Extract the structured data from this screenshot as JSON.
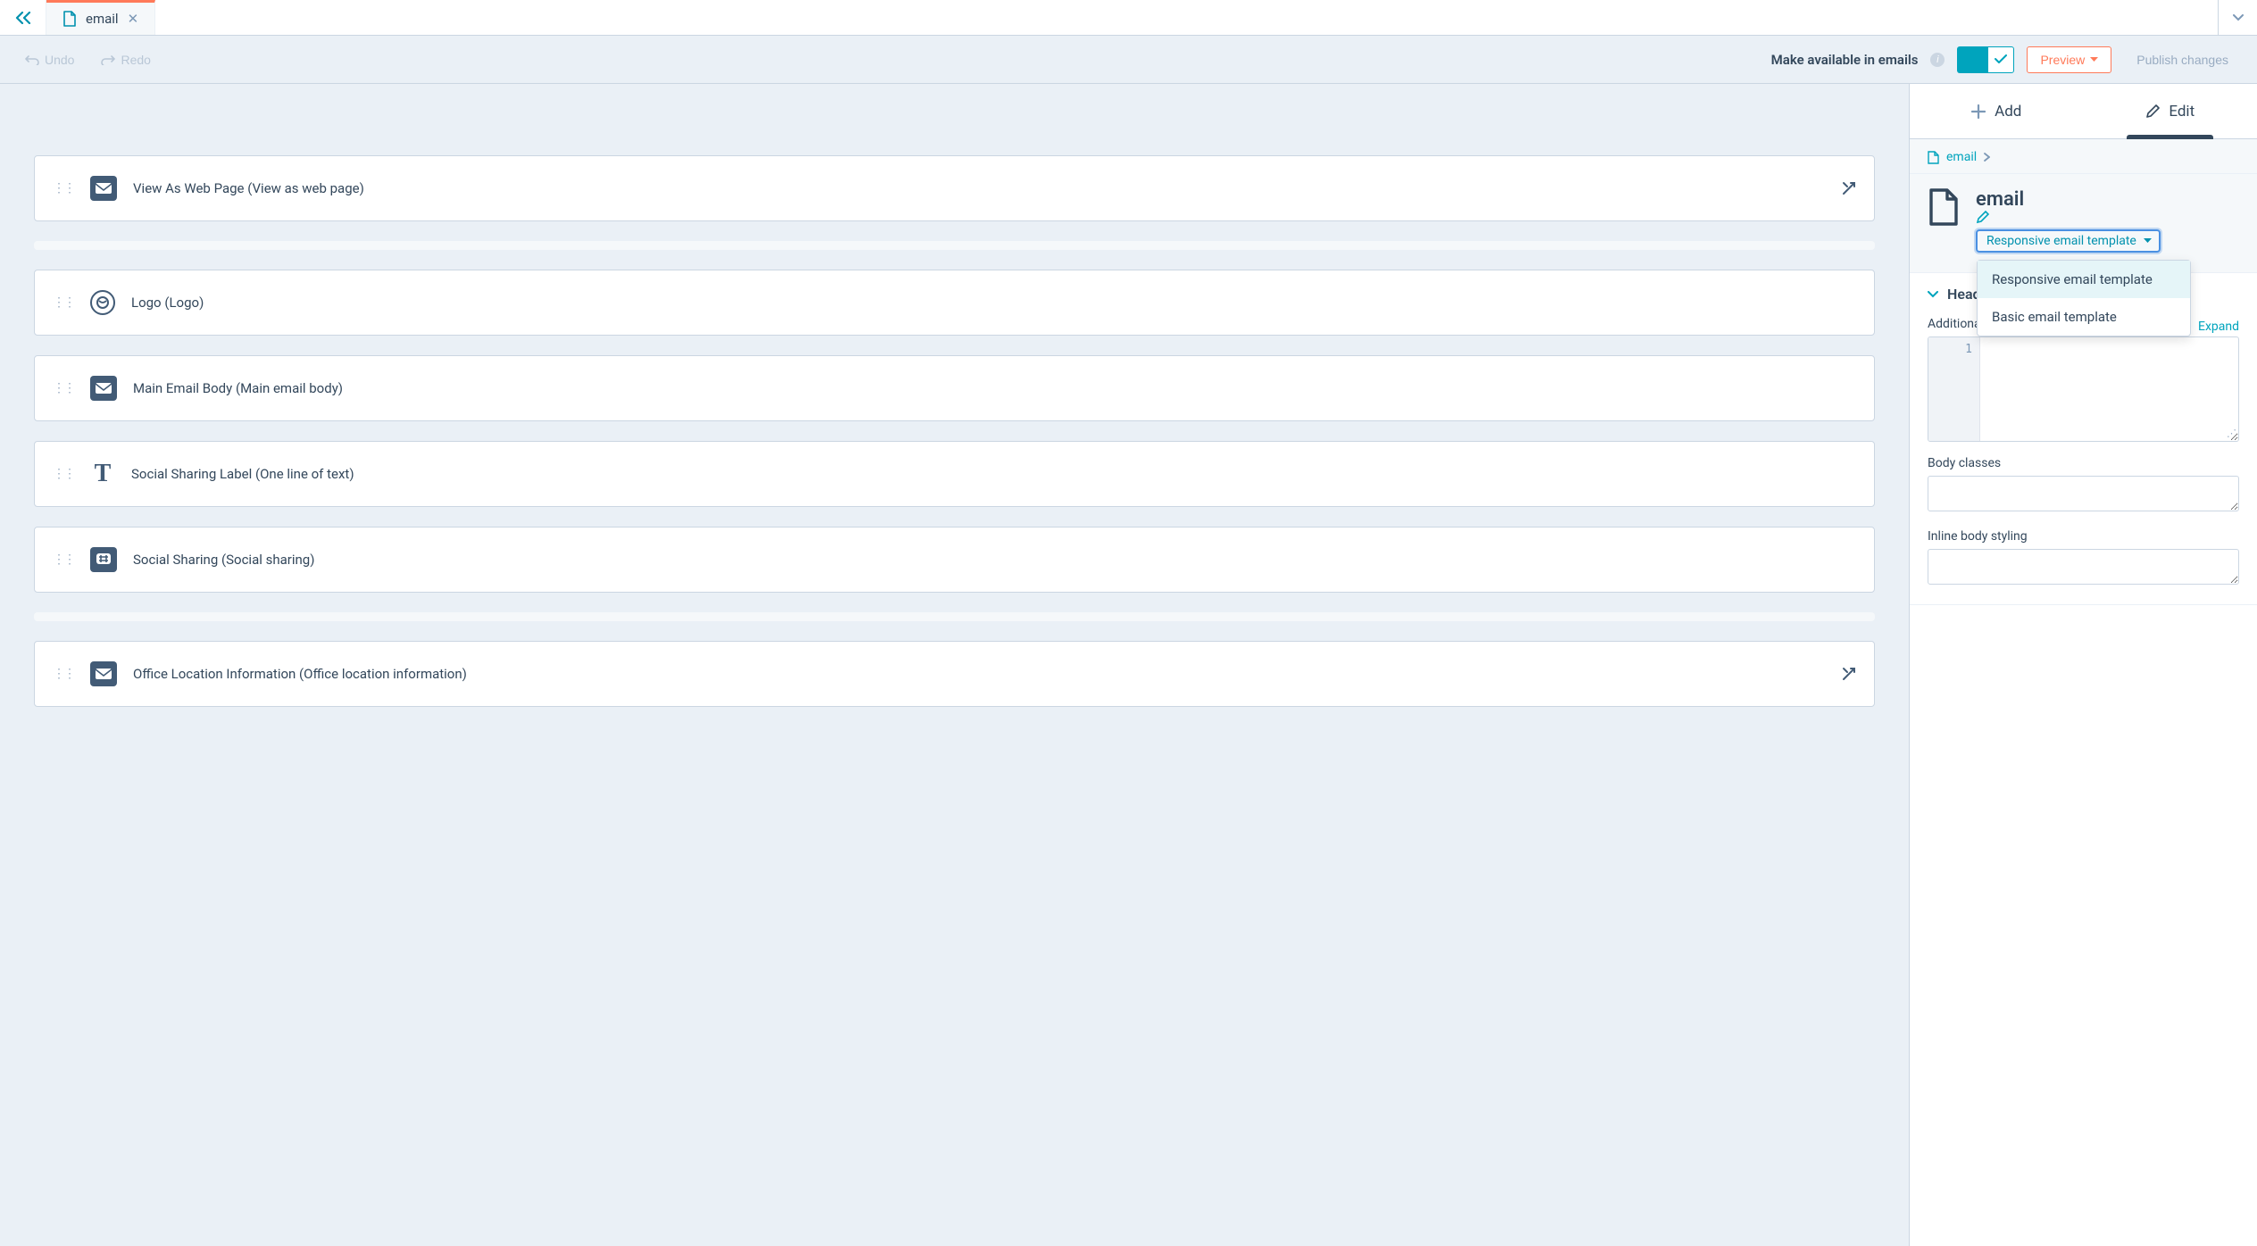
{
  "tab": {
    "label": "email"
  },
  "toolbar": {
    "undo": "Undo",
    "redo": "Redo",
    "available_label": "Make available in emails",
    "preview": "Preview",
    "publish": "Publish changes"
  },
  "modules": [
    {
      "icon": "mail",
      "label": "View As Web Page (View as web page)",
      "actionIcon": true
    },
    {
      "divider": true
    },
    {
      "icon": "circle",
      "label": "Logo (Logo)"
    },
    {
      "icon": "mail",
      "label": "Main Email Body (Main email body)"
    },
    {
      "icon": "text",
      "label": "Social Sharing Label (One line of text)"
    },
    {
      "icon": "hash",
      "label": "Social Sharing (Social sharing)"
    },
    {
      "divider": true
    },
    {
      "icon": "mail",
      "label": "Office Location Information (Office location information)",
      "actionIcon": true
    }
  ],
  "panel": {
    "tabs": {
      "add": "Add",
      "edit": "Edit"
    },
    "breadcrumb": "email",
    "title": "email",
    "template_selected": "Responsive email template",
    "dropdown": [
      "Responsive email template",
      "Basic email template"
    ],
    "section_head": "Head options",
    "additional_markup_label": "Additional <head> markup",
    "expand": "Expand",
    "code_line": "1",
    "body_classes_label": "Body classes",
    "inline_body_label": "Inline body styling"
  }
}
